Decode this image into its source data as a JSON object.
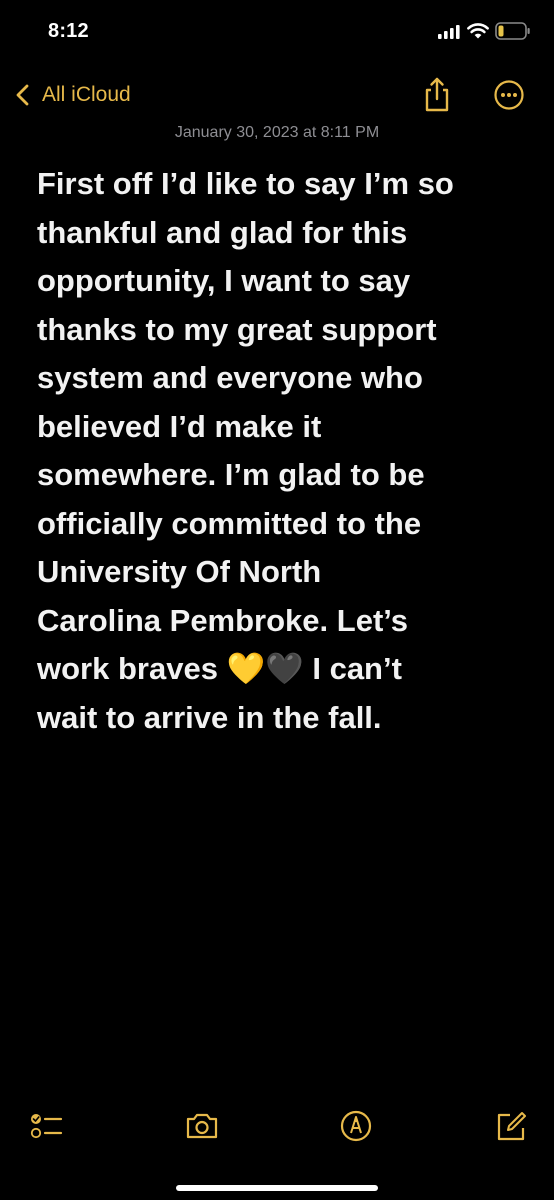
{
  "status_bar": {
    "time": "8:12",
    "icons": [
      "cellular-signal-icon",
      "wifi-icon",
      "battery-icon"
    ],
    "battery_color": "#e6c34a"
  },
  "nav": {
    "back_label": "All iCloud",
    "icons": [
      "back-chevron-icon",
      "share-icon",
      "more-icon"
    ],
    "accent_color": "#e7b94a"
  },
  "note": {
    "date": "January 30, 2023 at 8:11 PM",
    "body": "First off I’d like to say I’m so\nthankful and glad for this\nopportunity, I want to say\nthanks to my great support\nsystem and everyone who\nbelieved I’d make it\nsomewhere. I’m glad to be\nofficially committed to the\nUniversity Of North\nCarolina Pembroke. Let’s\nwork braves 💛🖤 I can’t\nwait to arrive in the fall."
  },
  "toolbar": {
    "icons": [
      "checklist-icon",
      "camera-icon",
      "markup-icon",
      "compose-icon"
    ]
  }
}
